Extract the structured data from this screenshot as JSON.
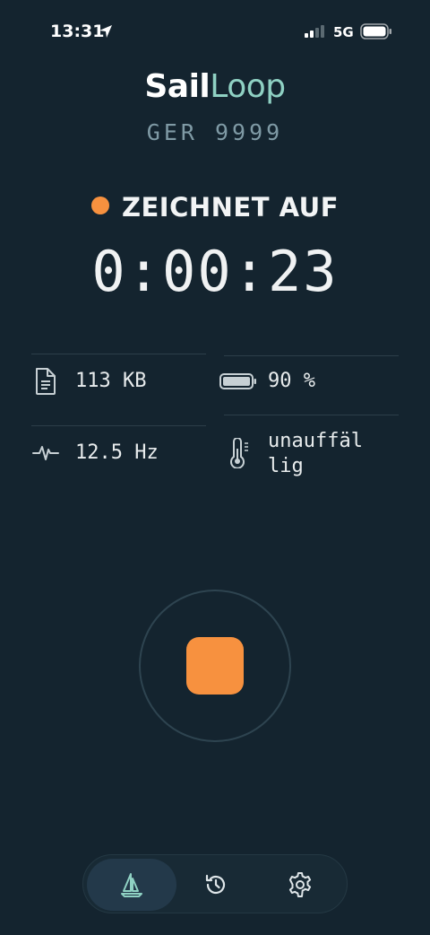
{
  "status_bar": {
    "time": "13:31",
    "network": "5G"
  },
  "header": {
    "logo_prefix": "Sail",
    "logo_l": "L",
    "logo_loop": "oo",
    "logo_suffix": "p",
    "boat_id": "GER 9999"
  },
  "recording": {
    "status": "ZEICHNET AUF",
    "elapsed": "0:00:23",
    "dot_color": "#f7913f"
  },
  "stats": {
    "file_size": "113 KB",
    "battery": "90 %",
    "frequency": "12.5 Hz",
    "temperature_line1": "unauffäl",
    "temperature_line2": "lig",
    "battery_level": 0.9
  },
  "controls": {
    "stop_color": "#f7913f"
  },
  "tabs": [
    {
      "name": "record",
      "icon": "sailboat-icon",
      "active": true
    },
    {
      "name": "history",
      "icon": "history-icon",
      "active": false
    },
    {
      "name": "settings",
      "icon": "gear-icon",
      "active": false
    }
  ],
  "colors": {
    "background": "#14242f",
    "accent": "#f7913f",
    "brand_teal": "#8fd1c3"
  }
}
